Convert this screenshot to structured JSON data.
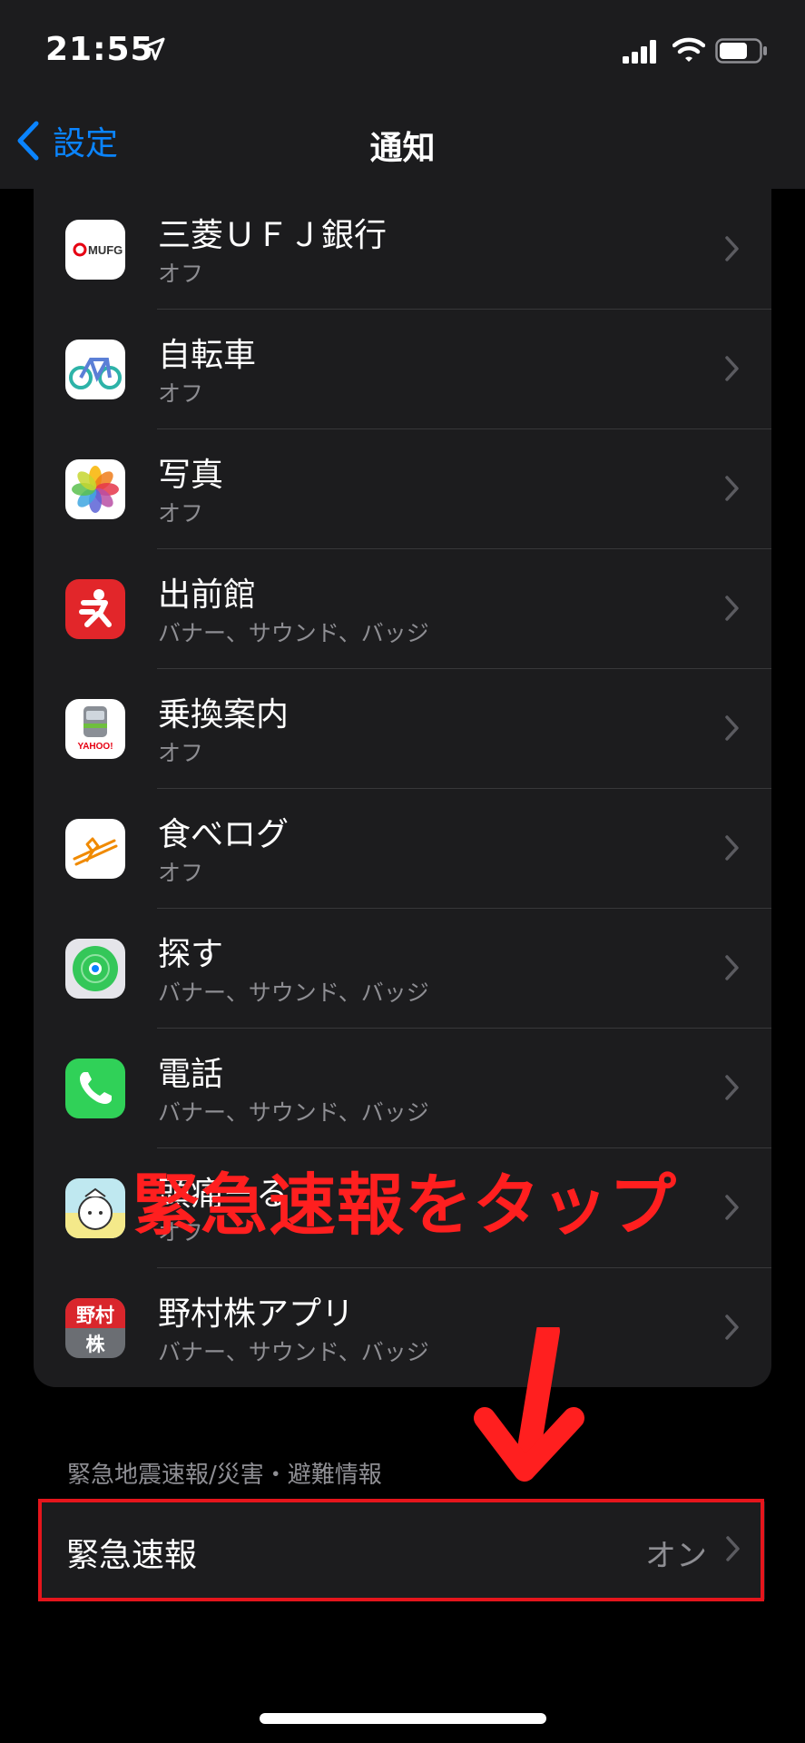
{
  "status": {
    "time": "21:55"
  },
  "nav": {
    "back_label": "設定",
    "title": "通知"
  },
  "apps": [
    {
      "name": "三菱ＵＦＪ銀行",
      "status": "オフ",
      "icon": "mufg-icon",
      "icon_text": "MUFG"
    },
    {
      "name": "自転車",
      "status": "オフ",
      "icon": "bicycle-icon"
    },
    {
      "name": "写真",
      "status": "オフ",
      "icon": "photos-icon"
    },
    {
      "name": "出前館",
      "status": "バナー、サウンド、バッジ",
      "icon": "demaekan-icon"
    },
    {
      "name": "乗換案内",
      "status": "オフ",
      "icon": "train-icon",
      "icon_text": "YAHOO!"
    },
    {
      "name": "食べログ",
      "status": "オフ",
      "icon": "tabelog-icon"
    },
    {
      "name": "探す",
      "status": "バナー、サウンド、バッジ",
      "icon": "findmy-icon"
    },
    {
      "name": "電話",
      "status": "バナー、サウンド、バッジ",
      "icon": "phone-icon"
    },
    {
      "name": "頭痛ーる",
      "status": "オフ",
      "icon": "zutool-icon"
    },
    {
      "name": "野村株アプリ",
      "status": "バナー、サウンド、バッジ",
      "icon": "nomura-icon",
      "icon_text_1": "野村",
      "icon_text_2": "株"
    }
  ],
  "section": {
    "header": "緊急地震速報/災害・避難情報",
    "row_label": "緊急速報",
    "row_value": "オン"
  },
  "annotation": {
    "text": "緊急速報をタップ",
    "color": "#ff1f1f"
  },
  "colors": {
    "accent": "#0a84ff",
    "highlight": "#e5151c"
  }
}
